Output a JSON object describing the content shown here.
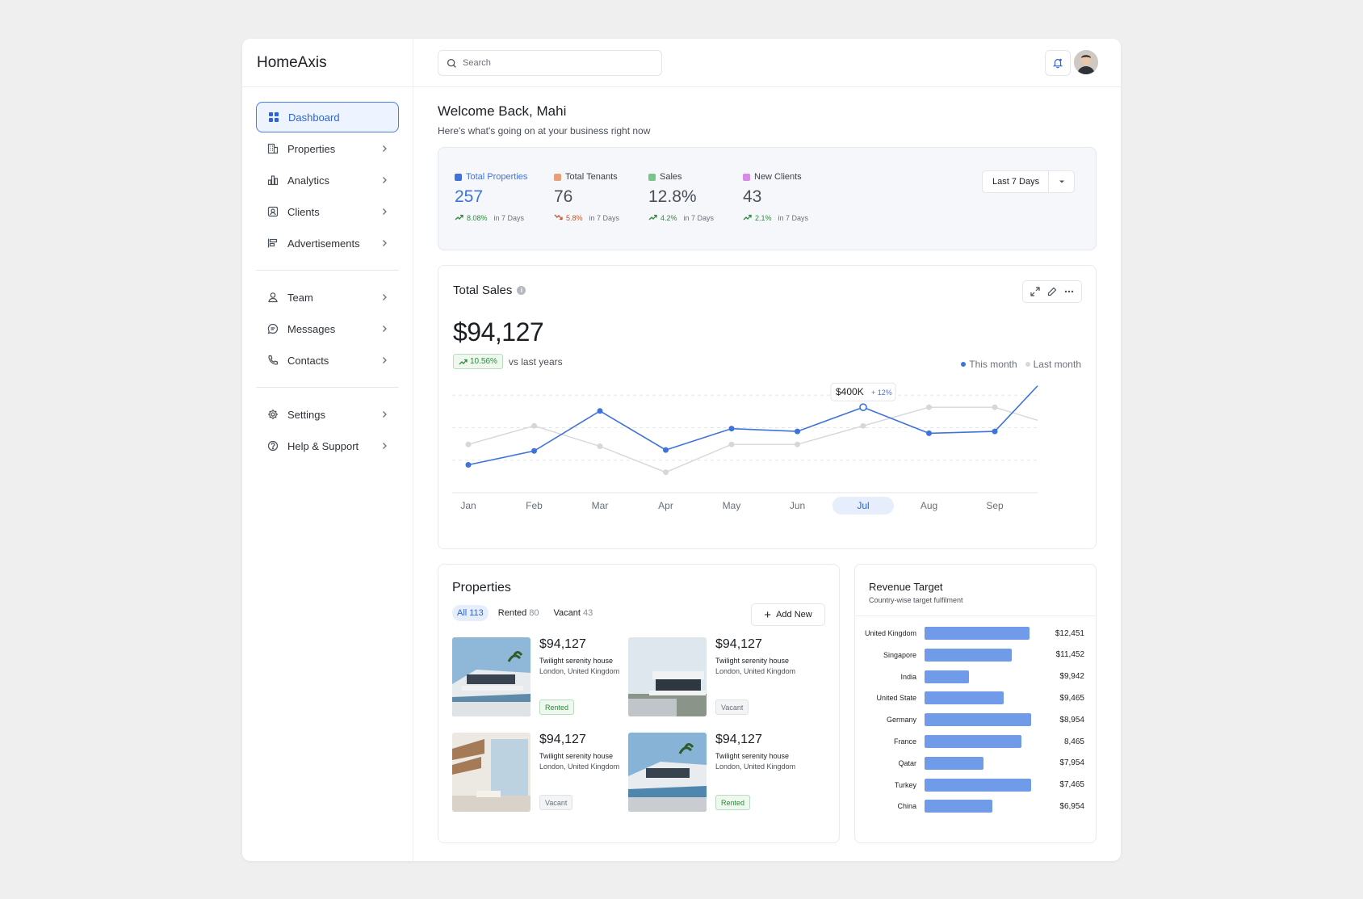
{
  "brand": "HomeAxis",
  "search": {
    "placeholder": "Search"
  },
  "sidebar": {
    "groups": [
      [
        {
          "label": "Dashboard",
          "icon": "grid-icon",
          "active": true
        },
        {
          "label": "Properties",
          "icon": "building-icon"
        },
        {
          "label": "Analytics",
          "icon": "bar-chart-icon"
        },
        {
          "label": "Clients",
          "icon": "contact-card-icon"
        },
        {
          "label": "Advertisements",
          "icon": "ads-icon"
        }
      ],
      [
        {
          "label": "Team",
          "icon": "user-icon"
        },
        {
          "label": "Messages",
          "icon": "chat-icon"
        },
        {
          "label": "Contacts",
          "icon": "phone-icon"
        }
      ],
      [
        {
          "label": "Settings",
          "icon": "gear-icon"
        },
        {
          "label": "Help & Support",
          "icon": "help-icon"
        }
      ]
    ]
  },
  "header": {
    "welcome": "Welcome Back, Mahi",
    "subtitle": "Here's what's going on at your business right now"
  },
  "kpis": [
    {
      "label": "Total Properties",
      "value": "257",
      "change": "8.08%",
      "period": "in 7 Days",
      "color": "#3f73dc",
      "trend": "up",
      "highlight": true
    },
    {
      "label": "Total Tenants",
      "value": "76",
      "change": "5.8%",
      "period": "in 7 Days",
      "color": "#e8a07a",
      "trend": "down"
    },
    {
      "label": "Sales",
      "value": "12.8%",
      "change": "4.2%",
      "period": "in 7 Days",
      "color": "#7cc58a",
      "trend": "up"
    },
    {
      "label": "New Clients",
      "value": "43",
      "change": "2.1%",
      "period": "in 7 Days",
      "color": "#d68be6",
      "trend": "up"
    }
  ],
  "period_select": {
    "value": "Last 7 Days"
  },
  "sales": {
    "title": "Total Sales",
    "value": "$94,127",
    "change": "10.56%",
    "change_label": "vs last years",
    "tooltip_value": "$400K",
    "tooltip_change": "+ 12%",
    "legend_this": "This month",
    "legend_last": "Last month"
  },
  "chart_data": {
    "type": "line",
    "categories": [
      "Jan",
      "Feb",
      "Mar",
      "Apr",
      "May",
      "Jun",
      "Jul",
      "Aug",
      "Sep"
    ],
    "highlighted_category": "Jul",
    "series": [
      {
        "name": "This month",
        "color": "#3f73dc",
        "values": [
          30,
          45,
          88,
          46,
          69,
          66,
          92,
          64,
          66
        ],
        "end_value": 115
      },
      {
        "name": "Last month",
        "color": "#d5d7da",
        "values": [
          52,
          72,
          50,
          22,
          52,
          52,
          72,
          92,
          92
        ],
        "end_value": 78
      }
    ],
    "ylim": [
      0,
      120
    ],
    "grid": true
  },
  "properties": {
    "title": "Properties",
    "tabs": [
      {
        "label": "All",
        "count": "113",
        "active": true
      },
      {
        "label": "Rented",
        "count": "80"
      },
      {
        "label": "Vacant",
        "count": "43"
      }
    ],
    "add_label": "Add New",
    "items": [
      {
        "price": "$94,127",
        "name": "Twilight serenity house",
        "location": "London, United Kingdom",
        "status": "Rented"
      },
      {
        "price": "$94,127",
        "name": "Twilight serenity house",
        "location": "London, United Kingdom",
        "status": "Vacant"
      },
      {
        "price": "$94,127",
        "name": "Twilight serenity house",
        "location": "London, United Kingdom",
        "status": "Vacant"
      },
      {
        "price": "$94,127",
        "name": "Twilight serenity house",
        "location": "London, United Kingdom",
        "status": "Rented"
      }
    ]
  },
  "revenue": {
    "title": "Revenue Target",
    "subtitle": "Country-wise target fulfilment",
    "rows": [
      {
        "country": "United Kingdom",
        "amount": "$12,451",
        "fill": 0.9
      },
      {
        "country": "Singapore",
        "amount": "$11,452",
        "fill": 0.75
      },
      {
        "country": "India",
        "amount": "$9,942",
        "fill": 0.38
      },
      {
        "country": "United State",
        "amount": "$9,465",
        "fill": 0.68
      },
      {
        "country": "Germany",
        "amount": "$8,954",
        "fill": 0.92
      },
      {
        "country": "France",
        "amount": "8,465",
        "fill": 0.83
      },
      {
        "country": "Qatar",
        "amount": "$7,954",
        "fill": 0.51
      },
      {
        "country": "Turkey",
        "amount": "$7,465",
        "fill": 0.92
      },
      {
        "country": "China",
        "amount": "$6,954",
        "fill": 0.58
      }
    ]
  }
}
